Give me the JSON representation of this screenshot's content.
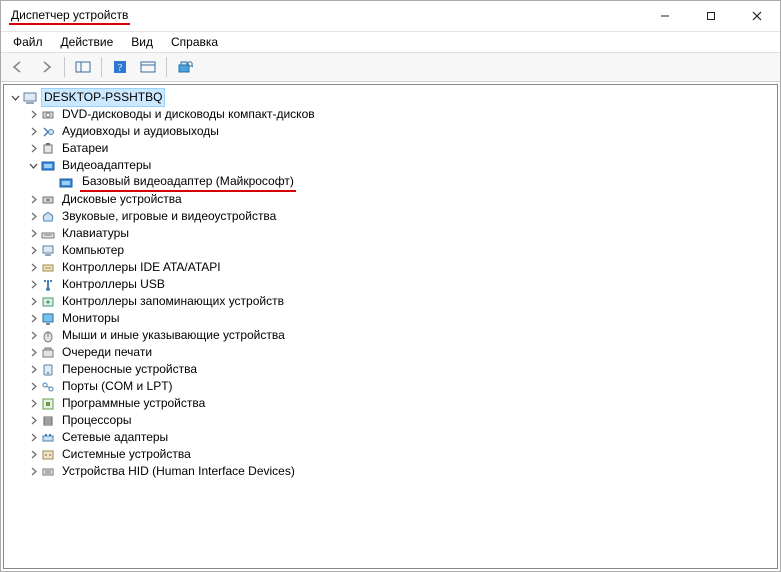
{
  "window": {
    "title": "Диспетчер устройств"
  },
  "menu": {
    "file": "Файл",
    "action": "Действие",
    "view": "Вид",
    "help": "Справка"
  },
  "tree": {
    "root": "DESKTOP-PSSHTBQ",
    "categories": [
      {
        "label": "DVD-дисководы и дисководы компакт-дисков",
        "expanded": false
      },
      {
        "label": "Аудиовходы и аудиовыходы",
        "expanded": false
      },
      {
        "label": "Батареи",
        "expanded": false
      },
      {
        "label": "Видеоадаптеры",
        "expanded": true,
        "children": [
          {
            "label": "Базовый видеоадаптер (Майкрософт)"
          }
        ]
      },
      {
        "label": "Дисковые устройства",
        "expanded": false
      },
      {
        "label": "Звуковые, игровые и видеоустройства",
        "expanded": false
      },
      {
        "label": "Клавиатуры",
        "expanded": false
      },
      {
        "label": "Компьютер",
        "expanded": false
      },
      {
        "label": "Контроллеры IDE ATA/ATAPI",
        "expanded": false
      },
      {
        "label": "Контроллеры USB",
        "expanded": false
      },
      {
        "label": "Контроллеры запоминающих устройств",
        "expanded": false
      },
      {
        "label": "Мониторы",
        "expanded": false
      },
      {
        "label": "Мыши и иные указывающие устройства",
        "expanded": false
      },
      {
        "label": "Очереди печати",
        "expanded": false
      },
      {
        "label": "Переносные устройства",
        "expanded": false
      },
      {
        "label": "Порты (COM и LPT)",
        "expanded": false
      },
      {
        "label": "Программные устройства",
        "expanded": false
      },
      {
        "label": "Процессоры",
        "expanded": false
      },
      {
        "label": "Сетевые адаптеры",
        "expanded": false
      },
      {
        "label": "Системные устройства",
        "expanded": false
      },
      {
        "label": "Устройства HID (Human Interface Devices)",
        "expanded": false
      }
    ]
  }
}
